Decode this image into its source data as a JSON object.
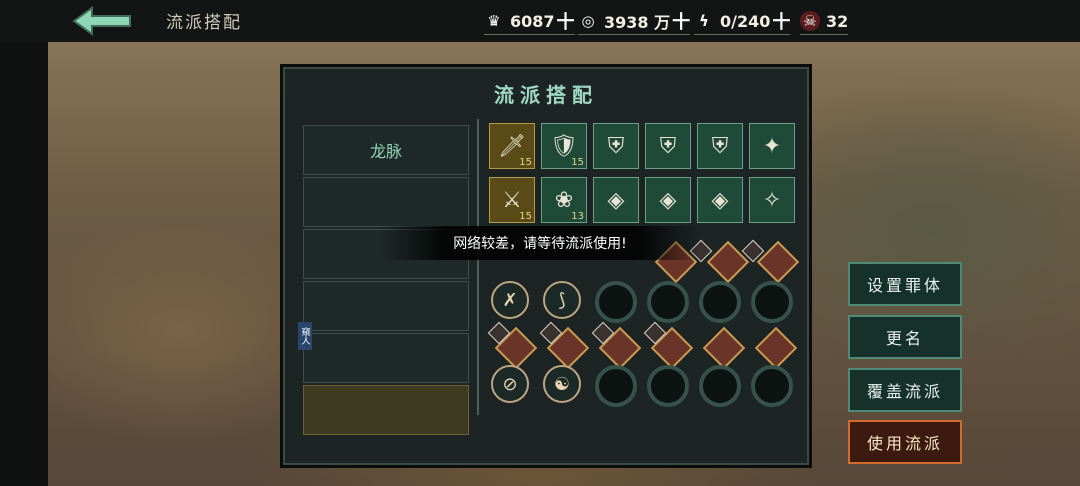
{
  "header": {
    "title": "流派搭配",
    "resources": [
      {
        "icon": "ingot-icon",
        "value": "6087",
        "plus": "十"
      },
      {
        "icon": "coin-icon",
        "value": "3938 万",
        "plus": "十"
      },
      {
        "icon": "lightning-icon",
        "value": "0/240",
        "plus": "十"
      },
      {
        "icon": "demon-mask-icon",
        "value": "32",
        "plus": ""
      }
    ]
  },
  "panel": {
    "title": "流派搭配",
    "slots": [
      "龙脉",
      "",
      "",
      "",
      "",
      ""
    ],
    "side_tag": "窺人"
  },
  "toast": "网络较差，请等待流派使用!",
  "equipment": {
    "row1": [
      {
        "icon": "staff-icon",
        "level": "15",
        "color": "gold"
      },
      {
        "icon": "gauntlet-icon",
        "level": "15",
        "color": "green"
      },
      {
        "icon": "armor-icon",
        "level": "",
        "color": "green"
      },
      {
        "icon": "robe-icon",
        "level": "",
        "color": "green"
      },
      {
        "icon": "pauldron-icon",
        "level": "",
        "color": "green"
      },
      {
        "icon": "amulet-icon",
        "level": "",
        "color": "green"
      }
    ],
    "row2": [
      {
        "icon": "claw-icon",
        "level": "15",
        "color": "gold"
      },
      {
        "icon": "lotus-icon",
        "level": "13",
        "color": "green"
      },
      {
        "icon": "bracer-icon",
        "level": "",
        "color": "green"
      },
      {
        "icon": "vest-icon",
        "level": "",
        "color": "green"
      },
      {
        "icon": "helm-icon",
        "level": "",
        "color": "green"
      },
      {
        "icon": "boot-icon",
        "level": "",
        "color": "green"
      }
    ]
  },
  "buttons": {
    "set_body": "设置罪体",
    "rename": "更名",
    "overwrite": "覆盖流派",
    "use": "使用流派"
  }
}
